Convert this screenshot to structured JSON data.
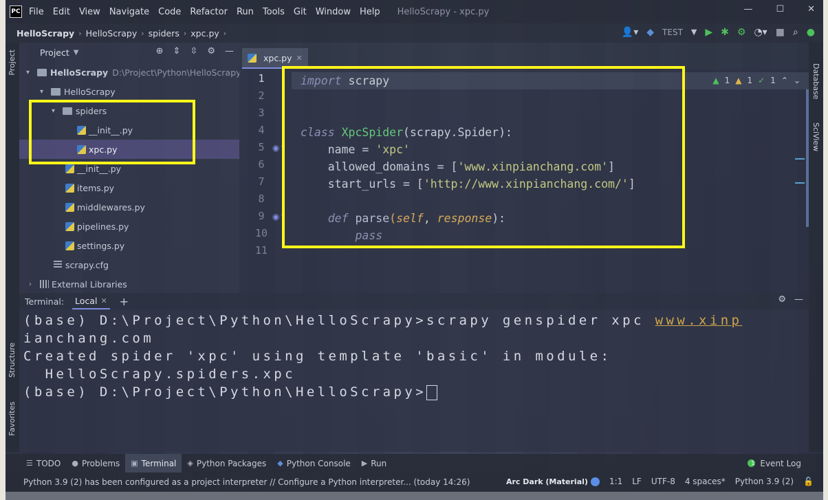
{
  "window": {
    "title": "HelloScrapy - xpc.py",
    "app_logo": "PC",
    "menu": [
      "File",
      "Edit",
      "View",
      "Navigate",
      "Code",
      "Refactor",
      "Run",
      "Tools",
      "Git",
      "Window",
      "Help"
    ],
    "controls": {
      "minimize": "—",
      "maximize": "☐",
      "close": "✕"
    }
  },
  "navbar": {
    "breadcrumb": [
      "HelloScrapy",
      "HelloScrapy",
      "spiders",
      "xpc.py"
    ],
    "run_config": "TEST"
  },
  "left_stripe": {
    "project": "Project",
    "structure": "Structure",
    "favorites": "Favorites"
  },
  "right_stripe": {
    "database": "Database",
    "sciview": "SciView"
  },
  "project_panel": {
    "title": "Project",
    "tree": [
      {
        "label": "HelloScrapy",
        "detail": "D:\\Project\\Python\\HelloScrapy",
        "type": "folder"
      },
      {
        "label": "HelloScrapy",
        "type": "folder"
      },
      {
        "label": "spiders",
        "type": "folder"
      },
      {
        "label": "__init__.py",
        "type": "py"
      },
      {
        "label": "xpc.py",
        "type": "py"
      },
      {
        "label": "__init__.py",
        "type": "py"
      },
      {
        "label": "items.py",
        "type": "py"
      },
      {
        "label": "middlewares.py",
        "type": "py"
      },
      {
        "label": "pipelines.py",
        "type": "py"
      },
      {
        "label": "settings.py",
        "type": "py"
      },
      {
        "label": "scrapy.cfg",
        "type": "cfg"
      },
      {
        "label": "External Libraries",
        "type": "libs"
      }
    ]
  },
  "editor": {
    "tab": "xpc.py",
    "inspections": {
      "warnings_a": "1",
      "warnings_b": "1",
      "typos": "1"
    },
    "line_numbers": [
      "1",
      "2",
      "3",
      "4",
      "5",
      "6",
      "7",
      "8",
      "9",
      "10",
      "11"
    ],
    "code": {
      "l1_kw": "import",
      "l1_rest": " scrapy",
      "l4_kw": "class",
      "l4_cls": "XpcSpider",
      "l4_rest": "(scrapy.Spider):",
      "l5_a": "    name = ",
      "l5_str": "'xpc'",
      "l6_a": "    allowed_domains = [",
      "l6_str": "'www.xinpianchang.com'",
      "l6_b": "]",
      "l7_a": "    start_urls = [",
      "l7_str": "'http://www.xinpianchang.com/'",
      "l7_b": "]",
      "l9_kw": "    def",
      "l9_fn": " parse",
      "l9_p1": "(",
      "l9_self": "self",
      "l9_sep": ", ",
      "l9_resp": "response",
      "l9_end": "):",
      "l10": "        pass"
    }
  },
  "terminal": {
    "label": "Terminal:",
    "tab": "Local",
    "lines": {
      "l1_a": "(base) D:\\Project\\Python\\HelloScrapy>scrapy genspider xpc ",
      "l1_link": "www.xinp",
      "l2_link": "ianchang.com",
      "l3": "Created spider 'xpc' using template 'basic' in module:",
      "l4": "  HelloScrapy.spiders.xpc",
      "l5": "(base) D:\\Project\\Python\\HelloScrapy>"
    }
  },
  "toolbar": {
    "todo": "TODO",
    "problems": "Problems",
    "terminal": "Terminal",
    "python_packages": "Python Packages",
    "python_console": "Python Console",
    "run": "Run",
    "event_log": "Event Log",
    "event_count": "1"
  },
  "statusbar": {
    "message": "Python 3.9 (2) has been configured as a project interpreter // Configure a Python interpreter... (today 14:26)",
    "theme": "Arc Dark (Material)",
    "position": "1:1",
    "line_sep": "LF",
    "encoding": "UTF-8",
    "indent": "4 spaces*",
    "interpreter": "Python 3.9 (2)"
  },
  "colors": {
    "highlight": "#fff61a",
    "accent": "#7e8be0",
    "run_green": "#4ec15a"
  }
}
